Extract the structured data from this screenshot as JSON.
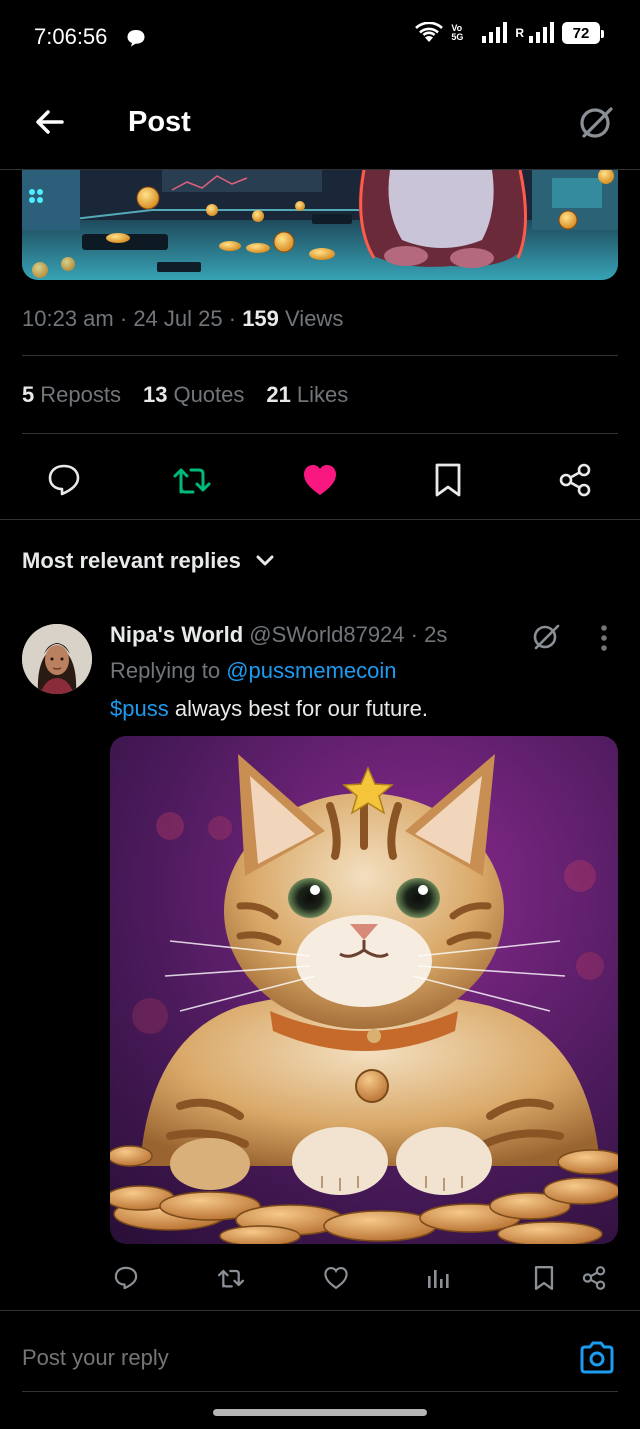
{
  "status_bar": {
    "time": "7:06:56",
    "network_label": "Vo 5G",
    "roaming_label": "R",
    "battery": "72"
  },
  "header": {
    "title": "Post",
    "back_icon": "arrow-left-icon",
    "grok_icon": "grok-slash-icon"
  },
  "post": {
    "time": "10:23 am",
    "date": "24 Jul 25",
    "views_count": "159",
    "views_label": "Views",
    "stats": [
      {
        "count": "5",
        "label": "Reposts"
      },
      {
        "count": "13",
        "label": "Quotes"
      },
      {
        "count": "21",
        "label": "Likes"
      }
    ],
    "actions": [
      {
        "name": "reply",
        "icon": "speech-bubble-icon"
      },
      {
        "name": "repost",
        "icon": "repost-icon",
        "active_color": "#00ba7c"
      },
      {
        "name": "like",
        "icon": "heart-filled-icon",
        "active_color": "#f91880"
      },
      {
        "name": "bookmark",
        "icon": "bookmark-icon"
      },
      {
        "name": "share",
        "icon": "share-icon"
      }
    ]
  },
  "replies": {
    "sort_label": "Most relevant replies",
    "items": [
      {
        "name": "Nipa's World",
        "handle": "@SWorld87924",
        "age": "2s",
        "replying_prefix": "Replying to",
        "replying_to": "@pussmemecoin",
        "cashtag": "$puss",
        "text": " always best for our future."
      }
    ]
  },
  "compose": {
    "placeholder": "Post your reply"
  },
  "colors": {
    "background": "#000000",
    "text_primary": "#e7e9ea",
    "text_secondary": "#71767b",
    "link": "#1d9bf0",
    "divider": "#2f3336"
  }
}
